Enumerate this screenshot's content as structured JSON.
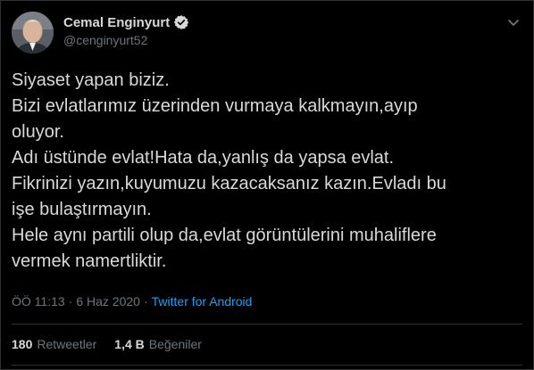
{
  "author": {
    "display_name": "Cemal Enginyurt",
    "handle": "@cenginyurt52",
    "verified": true
  },
  "tweet": {
    "lines": [
      "Siyaset yapan biziz.",
      "Bizi evlatlarımız üzerinden vurmaya kalkmayın,ayıp",
      "oluyor.",
      "Adı üstünde evlat!Hata da,yanlış da yapsa evlat.",
      "Fikrinizi yazın,kuyumuzu kazacaksanız kazın.Evladı bu",
      "işe bulaştırmayın.",
      "Hele aynı partili olup da,evlat görüntülerini muhaliflere",
      "vermek namertliktir."
    ]
  },
  "meta": {
    "time": "ÖÖ 11:13",
    "separator": "·",
    "date": "6 Haz 2020",
    "separator2": "·",
    "source": "Twitter for Android"
  },
  "stats": {
    "retweets_count": "180",
    "retweets_label": "Retweetler",
    "likes_count": "1,4 B",
    "likes_label": "Beğeniler"
  },
  "colors": {
    "background": "#000000",
    "text": "#d9d9d9",
    "secondary": "#6e767d",
    "accent": "#1da1f2"
  },
  "icons": {
    "verified": "verified-badge-icon",
    "more": "chevron-down-icon"
  }
}
